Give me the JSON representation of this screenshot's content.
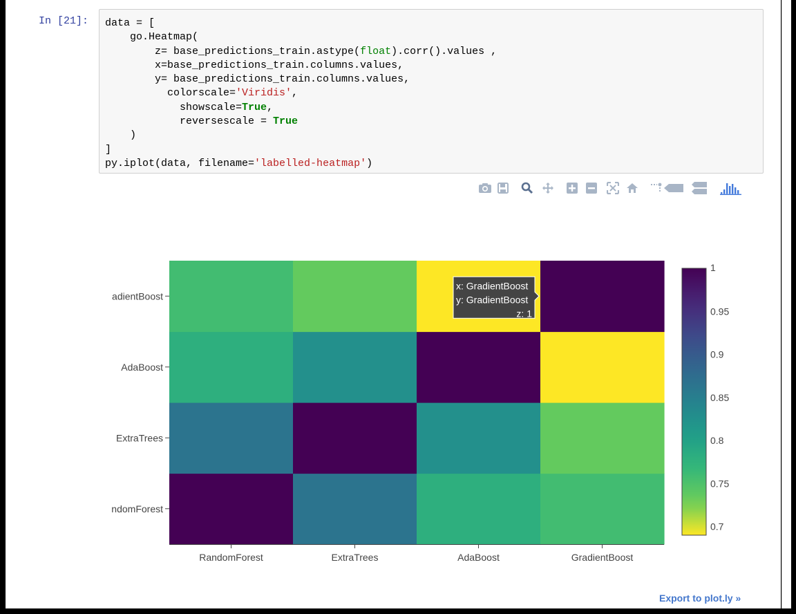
{
  "cell": {
    "prompt": "In [21]:",
    "code_lines": [
      [
        {
          "t": "data = ["
        }
      ],
      [
        {
          "t": "    go.Heatmap("
        }
      ],
      [
        {
          "t": "        z= base_predictions_train.astype("
        },
        {
          "t": "float",
          "c": "bi"
        },
        {
          "t": ").corr().values ,"
        }
      ],
      [
        {
          "t": "        x=base_predictions_train.columns.values,"
        }
      ],
      [
        {
          "t": "        y= base_predictions_train.columns.values,"
        }
      ],
      [
        {
          "t": "          colorscale="
        },
        {
          "t": "'Viridis'",
          "c": "str"
        },
        {
          "t": ","
        }
      ],
      [
        {
          "t": "            showscale="
        },
        {
          "t": "True",
          "c": "kw"
        },
        {
          "t": ","
        }
      ],
      [
        {
          "t": "            reversescale = "
        },
        {
          "t": "True",
          "c": "kw"
        }
      ],
      [
        {
          "t": "    )"
        }
      ],
      [
        {
          "t": "]"
        }
      ],
      [
        {
          "t": "py.iplot(data, filename="
        },
        {
          "t": "'labelled-heatmap'",
          "c": "str"
        },
        {
          "t": ")"
        }
      ]
    ]
  },
  "modebar": {
    "icons": [
      "camera-icon",
      "save-icon",
      "zoom-icon",
      "pan-icon",
      "zoom-in-icon",
      "zoom-out-icon",
      "autoscale-icon",
      "home-icon",
      "spike-lines-icon",
      "hover-closest-icon",
      "hover-compare-icon",
      "plotly-logo-icon"
    ],
    "color": "#a8b5c6",
    "logo_color": "#447adb"
  },
  "chart_data": {
    "type": "heatmap",
    "colorscale": "Viridis",
    "reversescale": true,
    "showscale": true,
    "x": [
      "RandomForest",
      "ExtraTrees",
      "AdaBoost",
      "GradientBoost"
    ],
    "y": [
      "RandomForest",
      "ExtraTrees",
      "AdaBoost",
      "GradientBoost"
    ],
    "y_tick_labels": [
      "ndomForest",
      "ExtraTrees",
      "AdaBoost",
      "adientBoost"
    ],
    "z": [
      [
        1,
        0.865,
        0.78,
        0.758
      ],
      [
        0.865,
        1,
        0.825,
        0.735
      ],
      [
        0.78,
        0.825,
        1,
        0.69
      ],
      [
        0.758,
        0.735,
        0.69,
        1
      ]
    ],
    "zmin": 0.69,
    "zmax": 1,
    "colorbar_ticks": [
      "1",
      "0.95",
      "0.9",
      "0.85",
      "0.8",
      "0.75",
      "0.7"
    ],
    "colorbar_tick_values": [
      1,
      0.95,
      0.9,
      0.85,
      0.8,
      0.75,
      0.7
    ],
    "hover": {
      "x_text": "x: GradientBoost",
      "y_text": "y: GradientBoost",
      "z_text": "z: 1",
      "row": 3,
      "col": 2
    }
  },
  "footer": {
    "export_label": "Export to plot.ly »"
  }
}
